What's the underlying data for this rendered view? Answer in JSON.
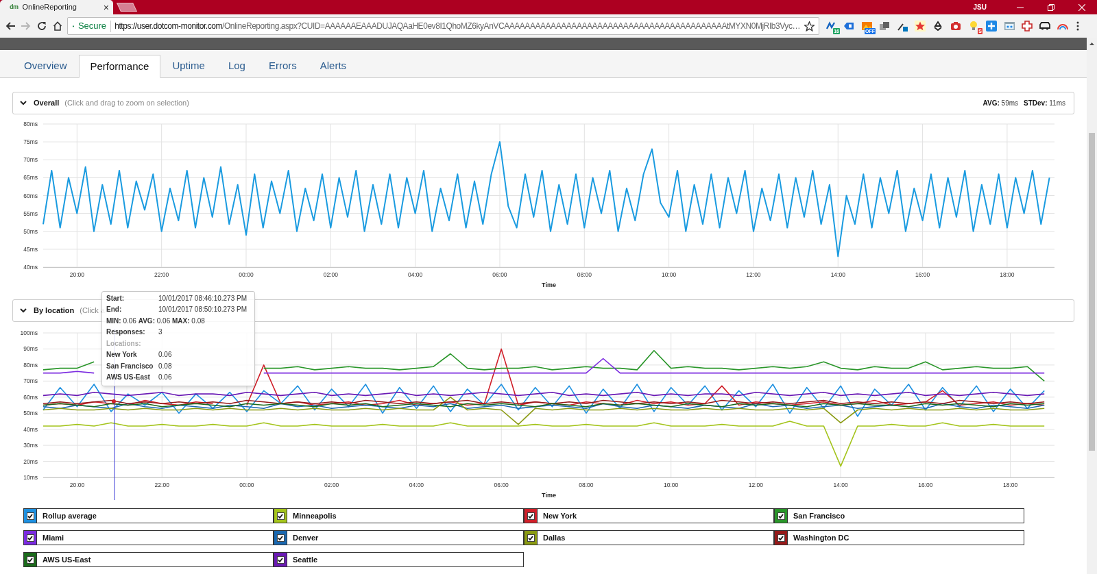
{
  "browser": {
    "tab": {
      "favicon": "dm",
      "title": "OnlineReporting",
      "close": "×"
    },
    "profile": "JSU",
    "address": {
      "security": "Secure",
      "url_host": "https://user.dotcom-monitor.com",
      "url_path": "/OnlineReporting.aspx?CUID=AAAAAAEAAADUJAQAaHE0ev8I1QhoMZ6kyAnVCAAAAAAAAAAAAAAAAAAAAAAAAAAAAAAAAAAAAAAAAAAAtMYXN0MjRIb3Vyc…"
    },
    "extensions": [
      {
        "kind": "pen",
        "badge": "16",
        "color": "#1fa463"
      },
      {
        "kind": "tag"
      },
      {
        "kind": "photo",
        "badge": "OFF",
        "color": "#1a73e8"
      },
      {
        "kind": "squares"
      },
      {
        "kind": "dropper"
      },
      {
        "kind": "star"
      },
      {
        "kind": "recycle"
      },
      {
        "kind": "camera"
      },
      {
        "kind": "bulb",
        "badge": "S",
        "color": "#e53935"
      },
      {
        "kind": "plus"
      },
      {
        "kind": "window"
      },
      {
        "kind": "medic"
      },
      {
        "kind": "car"
      },
      {
        "kind": "arc"
      }
    ]
  },
  "tabs": [
    {
      "label": "Overview",
      "selected": false
    },
    {
      "label": "Performance",
      "selected": true
    },
    {
      "label": "Uptime",
      "selected": false
    },
    {
      "label": "Log",
      "selected": false
    },
    {
      "label": "Errors",
      "selected": false
    },
    {
      "label": "Alerts",
      "selected": false
    }
  ],
  "overall": {
    "title": "Overall",
    "hint": "(Click and drag to zoom on selection)",
    "expanded": true,
    "stats": [
      {
        "label": "AVG:",
        "value": "59ms"
      },
      {
        "label": "STDev:",
        "value": "11ms"
      }
    ],
    "chart_data": {
      "type": "line",
      "xlabel": "Time",
      "ylim": [
        40,
        80
      ],
      "grid": true,
      "yticks": [
        {
          "value": 40,
          "label": "40ms"
        },
        {
          "value": 45,
          "label": "45ms"
        },
        {
          "value": 50,
          "label": "50ms"
        },
        {
          "value": 55,
          "label": "55ms"
        },
        {
          "value": 60,
          "label": "60ms"
        },
        {
          "value": 65,
          "label": "65ms"
        },
        {
          "value": 70,
          "label": "70ms"
        },
        {
          "value": 75,
          "label": "75ms"
        },
        {
          "value": 80,
          "label": "80ms"
        }
      ],
      "categories": [
        null,
        null,
        null,
        null,
        "20:00",
        null,
        null,
        null,
        null,
        null,
        null,
        null,
        null,
        null,
        "22:00",
        null,
        null,
        null,
        null,
        null,
        null,
        null,
        null,
        null,
        "00:00",
        null,
        null,
        null,
        null,
        null,
        null,
        null,
        null,
        null,
        "02:00",
        null,
        null,
        null,
        null,
        null,
        null,
        null,
        null,
        null,
        "04:00",
        null,
        null,
        null,
        null,
        null,
        null,
        null,
        null,
        null,
        "06:00",
        null,
        null,
        null,
        null,
        null,
        null,
        null,
        null,
        null,
        "08:00",
        null,
        null,
        null,
        null,
        null,
        null,
        null,
        null,
        null,
        "10:00",
        null,
        null,
        null,
        null,
        null,
        null,
        null,
        null,
        null,
        "12:00",
        null,
        null,
        null,
        null,
        null,
        null,
        null,
        null,
        null,
        "14:00",
        null,
        null,
        null,
        null,
        null,
        null,
        null,
        null,
        null,
        "16:00",
        null,
        null,
        null,
        null,
        null,
        null,
        null,
        null,
        null,
        "18:00",
        null,
        null,
        null,
        null,
        null
      ],
      "series": [
        {
          "color": "#1a9be0",
          "values": [
            52,
            67,
            51,
            65,
            55,
            68,
            50,
            63,
            52,
            67,
            51,
            64,
            56,
            66,
            50,
            62,
            53,
            67,
            51,
            65,
            54,
            68,
            52,
            63,
            49,
            66,
            51,
            64,
            55,
            67,
            50,
            62,
            53,
            66,
            51,
            65,
            54,
            67,
            50,
            63,
            52,
            66,
            51,
            65,
            55,
            67,
            50,
            62,
            53,
            66,
            51,
            64,
            52,
            66,
            75,
            57,
            51,
            66,
            54,
            67,
            50,
            63,
            52,
            66,
            51,
            65,
            55,
            67,
            50,
            62,
            53,
            66,
            73,
            58,
            54,
            67,
            50,
            63,
            52,
            66,
            51,
            65,
            55,
            67,
            50,
            62,
            53,
            66,
            51,
            65,
            54,
            67,
            52,
            63,
            43,
            60,
            52,
            66,
            51,
            65,
            55,
            67,
            50,
            62,
            53,
            66,
            51,
            65,
            54,
            67,
            50,
            63,
            52,
            66,
            51,
            65,
            55,
            67,
            52,
            65
          ]
        }
      ]
    }
  },
  "by_location": {
    "title": "By location",
    "hint": "(Click a",
    "expanded": true,
    "legend_checkboxes": [
      {
        "checked": true
      },
      {
        "checked": true
      },
      {
        "checked": true
      },
      {
        "checked": true
      },
      {
        "checked": true
      },
      {
        "checked": true
      },
      {
        "checked": true
      },
      {
        "checked": true
      },
      {
        "checked": true
      },
      {
        "checked": true
      }
    ],
    "chart_data": {
      "type": "line",
      "xlabel": "Time",
      "ylim": [
        10,
        100
      ],
      "grid": true,
      "legend": "bottom",
      "yticks": [
        {
          "value": 10,
          "label": "10ms"
        },
        {
          "value": 20,
          "label": "20ms"
        },
        {
          "value": 30,
          "label": "30ms"
        },
        {
          "value": 40,
          "label": "40ms"
        },
        {
          "value": 50,
          "label": "50ms"
        },
        {
          "value": 60,
          "label": "60ms"
        },
        {
          "value": 70,
          "label": "70ms"
        },
        {
          "value": 80,
          "label": "80ms"
        },
        {
          "value": 90,
          "label": "90ms"
        },
        {
          "value": 100,
          "label": "100ms"
        }
      ],
      "categories": [
        null,
        null,
        "20:00",
        null,
        null,
        null,
        null,
        "22:00",
        null,
        null,
        null,
        null,
        "00:00",
        null,
        null,
        null,
        null,
        "02:00",
        null,
        null,
        null,
        null,
        "04:00",
        null,
        null,
        null,
        null,
        "06:00",
        null,
        null,
        null,
        null,
        "08:00",
        null,
        null,
        null,
        null,
        "10:00",
        null,
        null,
        null,
        null,
        "12:00",
        null,
        null,
        null,
        null,
        "14:00",
        null,
        null,
        null,
        null,
        "16:00",
        null,
        null,
        null,
        null,
        "18:00",
        null,
        null
      ],
      "series": [
        {
          "name": "Rollup average",
          "color": "#1e90e0",
          "values": [
            52,
            66,
            54,
            68,
            51,
            62,
            55,
            63,
            50,
            62,
            53,
            63,
            51,
            64,
            56,
            67,
            52,
            65,
            54,
            68,
            50,
            66,
            53,
            67,
            51,
            65,
            55,
            68,
            52,
            66,
            54,
            67,
            50,
            65,
            53,
            68,
            51,
            66,
            55,
            67,
            52,
            64,
            54,
            68,
            50,
            66,
            53,
            67,
            48,
            65,
            55,
            68,
            52,
            66,
            54,
            67,
            51,
            65,
            53,
            64
          ]
        },
        {
          "name": "Minneapolis",
          "color": "#a4c41c",
          "values": [
            42,
            42,
            43,
            42,
            44,
            42,
            42,
            43,
            42,
            42,
            43,
            42,
            42,
            44,
            42,
            42,
            43,
            42,
            42,
            42,
            43,
            42,
            42,
            42,
            44,
            42,
            42,
            42,
            42,
            43,
            42,
            42,
            43,
            42,
            42,
            42,
            44,
            42,
            42,
            42,
            43,
            42,
            42,
            42,
            45,
            42,
            42,
            17,
            42,
            42,
            43,
            42,
            42,
            44,
            42,
            42,
            43,
            42,
            42,
            42
          ]
        },
        {
          "name": "New York",
          "color": "#d0202a",
          "values": [
            55,
            56,
            55,
            57,
            56,
            55,
            58,
            56,
            55,
            57,
            56,
            null,
            55,
            80,
            56,
            57,
            55,
            56,
            57,
            55,
            56,
            58,
            55,
            56,
            57,
            55,
            56,
            90,
            55,
            57,
            56,
            55,
            57,
            56,
            55,
            58,
            56,
            57,
            55,
            56,
            67,
            55,
            57,
            56,
            55,
            56,
            57,
            55,
            56,
            58,
            55,
            56,
            57,
            64,
            55,
            56,
            57,
            55,
            56,
            55
          ]
        },
        {
          "name": "San Francisco",
          "color": "#2a962a",
          "values": [
            77,
            78,
            78,
            82,
            null,
            null,
            null,
            null,
            null,
            null,
            null,
            null,
            null,
            78,
            78,
            79,
            77,
            78,
            79,
            78,
            78,
            77,
            78,
            79,
            87,
            78,
            77,
            78,
            78,
            79,
            77,
            78,
            79,
            78,
            78,
            77,
            89,
            78,
            79,
            78,
            78,
            77,
            78,
            79,
            78,
            79,
            82,
            78,
            77,
            79,
            78,
            78,
            82,
            77,
            78,
            79,
            78,
            78,
            79,
            70
          ]
        },
        {
          "name": "Miami",
          "color": "#7b2be0",
          "values": [
            75,
            75,
            76,
            75,
            null,
            null,
            null,
            null,
            null,
            null,
            null,
            null,
            null,
            75,
            75,
            75,
            75,
            75,
            75,
            75,
            75,
            75,
            75,
            75,
            75,
            75,
            75,
            75,
            75,
            75,
            75,
            75,
            75,
            84,
            75,
            75,
            75,
            75,
            75,
            75,
            75,
            75,
            75,
            75,
            75,
            75,
            75,
            75,
            75,
            75,
            75,
            75,
            75,
            75,
            75,
            75,
            75,
            75,
            75,
            75
          ]
        },
        {
          "name": "Denver",
          "color": "#1a68b0",
          "values": [
            54,
            53,
            55,
            54,
            53,
            56,
            54,
            53,
            55,
            54,
            53,
            55,
            54,
            53,
            56,
            54,
            55,
            53,
            54,
            55,
            54,
            53,
            55,
            54,
            56,
            53,
            54,
            55,
            53,
            54,
            55,
            54,
            53,
            56,
            54,
            53,
            55,
            54,
            53,
            55,
            54,
            53,
            56,
            54,
            55,
            53,
            54,
            55,
            53,
            54,
            55,
            54,
            53,
            56,
            54,
            53,
            55,
            54,
            53,
            55
          ]
        },
        {
          "name": "Dallas",
          "color": "#8a9a12",
          "values": [
            52,
            53,
            52,
            52,
            53,
            52,
            53,
            52,
            52,
            53,
            52,
            53,
            52,
            52,
            53,
            52,
            53,
            52,
            52,
            53,
            52,
            53,
            52,
            52,
            60,
            52,
            53,
            52,
            43,
            53,
            52,
            53,
            52,
            52,
            53,
            52,
            53,
            52,
            52,
            53,
            52,
            53,
            52,
            52,
            53,
            52,
            53,
            44,
            52,
            53,
            52,
            53,
            52,
            52,
            53,
            52,
            53,
            52,
            52,
            53
          ]
        },
        {
          "name": "Washington DC",
          "color": "#961a1a",
          "values": [
            56,
            57,
            56,
            57,
            58,
            56,
            57,
            56,
            57,
            56,
            57,
            56,
            58,
            57,
            56,
            57,
            56,
            57,
            56,
            58,
            57,
            56,
            57,
            56,
            57,
            58,
            56,
            57,
            56,
            57,
            56,
            57,
            56,
            58,
            57,
            56,
            57,
            56,
            57,
            56,
            58,
            57,
            56,
            57,
            56,
            57,
            58,
            56,
            57,
            56,
            57,
            56,
            57,
            56,
            58,
            57,
            56,
            57,
            56,
            57
          ]
        },
        {
          "name": "AWS US-East",
          "color": "#1b6a1b",
          "values": [
            55,
            56,
            55,
            54,
            56,
            55,
            56,
            54,
            55,
            56,
            55,
            54,
            56,
            55,
            56,
            55,
            54,
            56,
            55,
            56,
            54,
            55,
            56,
            55,
            54,
            56,
            55,
            56,
            55,
            54,
            56,
            55,
            54,
            56,
            55,
            56,
            55,
            54,
            56,
            55,
            54,
            56,
            55,
            56,
            55,
            54,
            56,
            55,
            56,
            55,
            55,
            54,
            56,
            55,
            56,
            55,
            54,
            56,
            55,
            56
          ]
        },
        {
          "name": "Seattle",
          "color": "#6a1ab4",
          "values": [
            61,
            62,
            61,
            63,
            62,
            61,
            62,
            63,
            61,
            62,
            62,
            61,
            63,
            62,
            61,
            62,
            63,
            61,
            62,
            61,
            62,
            63,
            61,
            62,
            61,
            62,
            63,
            62,
            61,
            62,
            63,
            61,
            62,
            61,
            62,
            63,
            61,
            62,
            61,
            62,
            62,
            61,
            63,
            62,
            61,
            62,
            63,
            61,
            62,
            61,
            62,
            63,
            61,
            62,
            61,
            62,
            63,
            62,
            61,
            62
          ]
        }
      ]
    }
  },
  "tooltip": {
    "rows": [
      {
        "kind": "field",
        "label": "Start:",
        "value": "10/01/2017 08:46:10.273 PM"
      },
      {
        "kind": "field",
        "label": "End:",
        "value": "10/01/2017 08:50:10.273 PM"
      },
      {
        "kind": "summary",
        "text": "**MIN:** 0.06 **AVG:** 0.06 **MAX:** 0.08"
      },
      {
        "kind": "field",
        "label": "Responses:",
        "value": "3"
      },
      {
        "kind": "heading",
        "text": "Locations:"
      },
      {
        "kind": "field",
        "label": "New York",
        "value": "0.06"
      },
      {
        "kind": "field",
        "label": "San Francisco",
        "value": "0.08"
      },
      {
        "kind": "field",
        "label": "AWS US-East",
        "value": "0.06"
      }
    ]
  }
}
